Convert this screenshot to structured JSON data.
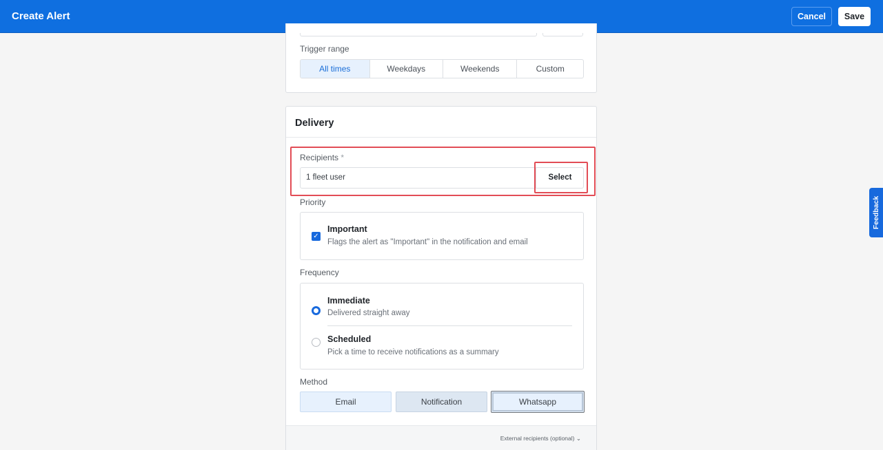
{
  "header": {
    "title": "Create Alert",
    "cancel_label": "Cancel",
    "save_label": "Save"
  },
  "trigger": {
    "label": "Trigger range",
    "options": [
      "All times",
      "Weekdays",
      "Weekends",
      "Custom"
    ],
    "selected": "All times"
  },
  "delivery": {
    "title": "Delivery",
    "recipients": {
      "label": "Recipients",
      "required_mark": "*",
      "value": "1 fleet user",
      "select_label": "Select"
    },
    "priority": {
      "label": "Priority",
      "option_title": "Important",
      "option_desc": "Flags the alert as \"Important\" in the notification and email",
      "checked": true
    },
    "frequency": {
      "label": "Frequency",
      "options": [
        {
          "title": "Immediate",
          "desc": "Delivered straight away",
          "selected": true
        },
        {
          "title": "Scheduled",
          "desc": "Pick a time to receive notifications as a summary",
          "selected": false
        }
      ]
    },
    "method": {
      "label": "Method",
      "options": [
        "Email",
        "Notification",
        "Whatsapp"
      ]
    },
    "external_recipients": "External recipients (optional)"
  },
  "feedback_label": "Feedback",
  "colors": {
    "header_bg": "#0f6fe0",
    "accent": "#1769dd",
    "highlight": "#e24c55"
  }
}
